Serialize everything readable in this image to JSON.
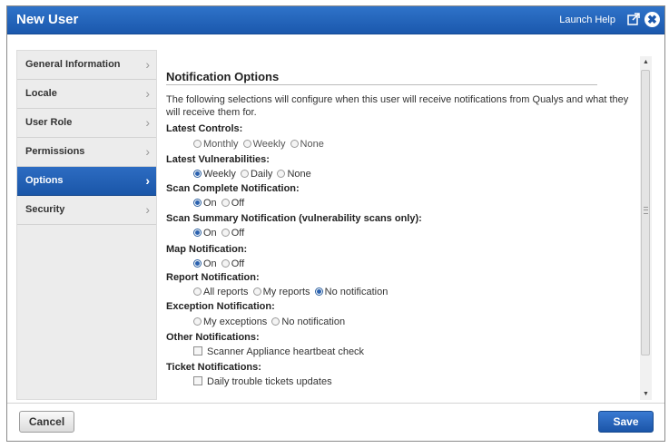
{
  "window": {
    "title": "New User",
    "help_link": "Launch Help",
    "close_glyph": "✖"
  },
  "sidebar": {
    "items": [
      {
        "label": "General Information"
      },
      {
        "label": "Locale"
      },
      {
        "label": "User Role"
      },
      {
        "label": "Permissions"
      },
      {
        "label": "Options",
        "active": true
      },
      {
        "label": "Security"
      }
    ],
    "chevron": "›"
  },
  "main": {
    "heading": "Notification Options",
    "description": "The following selections will configure when this user will receive notifications from Qualys and what they will receive them for.",
    "fields": {
      "latest_controls": {
        "label": "Latest Controls:",
        "options": [
          "Monthly",
          "Weekly",
          "None"
        ],
        "selected": null
      },
      "latest_vulns": {
        "label": "Latest Vulnerabilities:",
        "options": [
          "Weekly",
          "Daily",
          "None"
        ],
        "selected": "Weekly"
      },
      "scan_complete": {
        "label": "Scan Complete Notification:",
        "options": [
          "On",
          "Off"
        ],
        "selected": "On"
      },
      "scan_summary": {
        "label": "Scan Summary Notification (vulnerability scans only):",
        "options": [
          "On",
          "Off"
        ],
        "selected": "On"
      },
      "map": {
        "label": "Map Notification:",
        "options": [
          "On",
          "Off"
        ],
        "selected": "On"
      },
      "report": {
        "label": "Report Notification:",
        "options": [
          "All reports",
          "My reports",
          "No notification"
        ],
        "selected": "No notification"
      },
      "exception": {
        "label": "Exception Notification:",
        "options": [
          "My exceptions",
          "No notification"
        ],
        "selected": null
      },
      "other": {
        "label": "Other Notifications:",
        "checkbox": "Scanner Appliance heartbeat check",
        "checked": false
      },
      "ticket": {
        "label": "Ticket Notifications:",
        "checkbox": "Daily trouble tickets updates",
        "checked": false
      }
    }
  },
  "footer": {
    "cancel_label": "Cancel",
    "save_label": "Save"
  },
  "colors": {
    "titlebar": "#1b58ad",
    "active_nav": "#1a56a8",
    "save_button": "#1b55a8"
  }
}
